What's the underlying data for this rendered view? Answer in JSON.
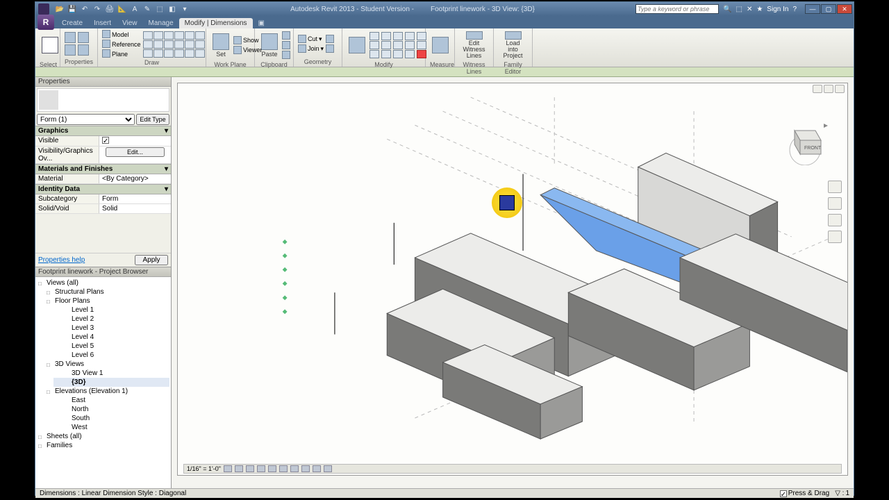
{
  "title": {
    "product": "Autodesk Revit 2013 - Student Version -",
    "doc": "Footprint linework - 3D View: {3D}"
  },
  "search": {
    "placeholder": "Type a keyword or phrase"
  },
  "signin": "Sign In",
  "tabs": [
    "Create",
    "Insert",
    "View",
    "Manage",
    "Modify | Dimensions"
  ],
  "active_tab": 4,
  "ribbon": {
    "select": "Select",
    "properties": "Properties",
    "draw": "Draw",
    "workplane": "Work Plane",
    "clipboard": "Clipboard",
    "geometry": "Geometry",
    "modify": "Modify",
    "measure": "Measure",
    "witness": "Witness Lines",
    "family": "Family Editor",
    "wp_items": {
      "set": "Set",
      "show": "Show",
      "viewer": "Viewer"
    },
    "draw_items": {
      "model": "Model",
      "reference": "Reference",
      "plane": "Plane"
    },
    "clip_items": {
      "paste": "Paste"
    },
    "geom_items": {
      "cut": "Cut",
      "join": "Join"
    },
    "witness_btn": "Edit\nWitness Lines",
    "family_btn": "Load into\nProject"
  },
  "properties": {
    "title": "Properties",
    "type_selector": "Form (1)",
    "edit_type": "Edit Type",
    "sections": {
      "graphics": "Graphics",
      "mats": "Materials and Finishes",
      "id": "Identity Data"
    },
    "rows": {
      "visible": {
        "k": "Visible",
        "v": ""
      },
      "visgr": {
        "k": "Visibility/Graphics Ov...",
        "v": "Edit..."
      },
      "material": {
        "k": "Material",
        "v": "<By Category>"
      },
      "subcat": {
        "k": "Subcategory",
        "v": "Form"
      },
      "solidvoid": {
        "k": "Solid/Void",
        "v": "Solid"
      }
    },
    "help": "Properties help",
    "apply": "Apply"
  },
  "browser": {
    "title": "Footprint linework - Project Browser",
    "tree": {
      "views": "Views (all)",
      "structural": "Structural Plans",
      "floor": "Floor Plans",
      "levels": [
        "Level 1",
        "Level 2",
        "Level 3",
        "Level 4",
        "Level 5",
        "Level 6"
      ],
      "threed": "3D Views",
      "threed_items": [
        "3D View 1",
        "{3D}"
      ],
      "elev": "Elevations (Elevation 1)",
      "elev_items": [
        "East",
        "North",
        "South",
        "West"
      ],
      "sheets": "Sheets (all)",
      "families": "Families"
    }
  },
  "viewbar": {
    "scale": "1/16\" = 1'-0\""
  },
  "status": {
    "left": "Dimensions : Linear Dimension Style : Diagonal",
    "pressdrag": "Press & Drag",
    "filter_count": "1"
  },
  "viewcube": {
    "front": "FRONT"
  },
  "chart_data": null
}
